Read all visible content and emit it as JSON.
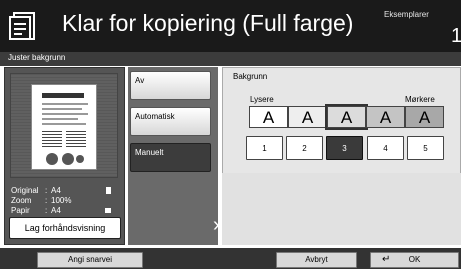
{
  "header": {
    "title": "Klar for kopiering (Full farge)",
    "copies_label": "Eksemplarer",
    "copies_count": "1"
  },
  "subheader": {
    "title": "Juster bakgrunn"
  },
  "preview": {
    "info": [
      {
        "key": "Original",
        "value": "A4"
      },
      {
        "key": "Zoom",
        "value": "100%"
      },
      {
        "key": "Papir",
        "value": "A4"
      }
    ],
    "preview_button": "Lag forhåndsvisning"
  },
  "options": {
    "items": [
      {
        "label": "Av",
        "selected": false
      },
      {
        "label": "Automatisk",
        "selected": false
      },
      {
        "label": "Manuelt",
        "selected": true
      }
    ]
  },
  "background": {
    "title": "Bakgrunn",
    "light_label": "Lysere",
    "dark_label": "Mørkere",
    "sample_glyph": "A",
    "sample_shades": [
      "#ffffff",
      "#eeeeee",
      "#dcdcdc",
      "#c4c4c4",
      "#a8a8a8"
    ],
    "levels": [
      "1",
      "2",
      "3",
      "4",
      "5"
    ],
    "selected_level": "3"
  },
  "footer": {
    "shortcut_label": "Angi snarvei",
    "cancel_label": "Avbryt",
    "ok_label": "OK",
    "ok_arrow": "↵"
  }
}
